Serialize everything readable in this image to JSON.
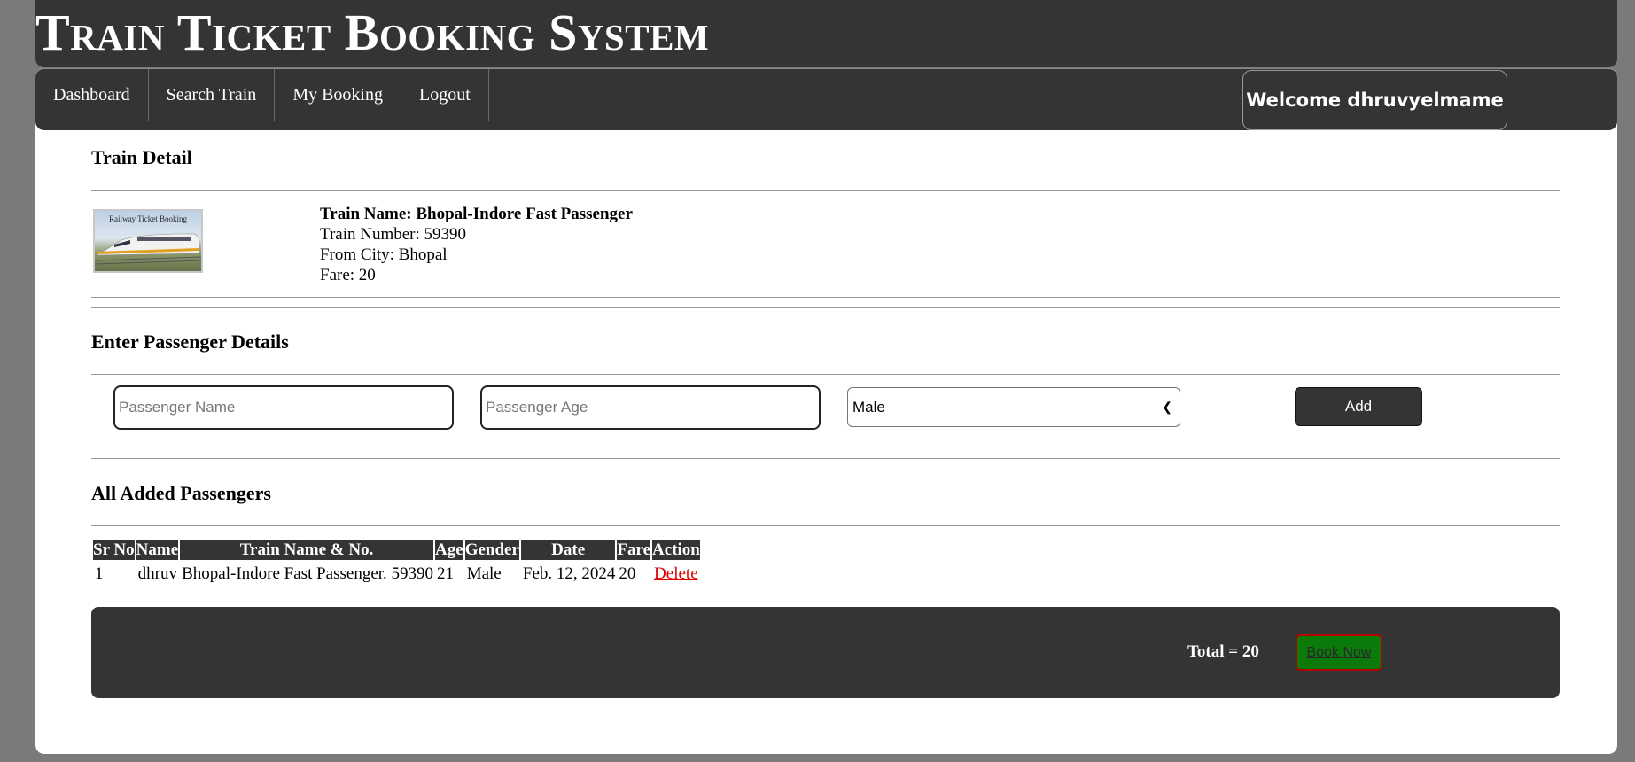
{
  "header": {
    "title": "Train Ticket Booking System"
  },
  "nav": {
    "items": [
      {
        "label": "Dashboard"
      },
      {
        "label": "Search Train"
      },
      {
        "label": "My Booking"
      },
      {
        "label": "Logout"
      }
    ],
    "welcome": "Welcome dhruvyelmame"
  },
  "train_detail": {
    "heading": "Train Detail",
    "image_caption": "Railway Ticket Booking",
    "name_line": "Train Name: Bhopal-Indore Fast Passenger",
    "number_line": "Train Number: 59390",
    "from_line": "From City: Bhopal",
    "fare_line": "Fare: 20"
  },
  "passenger_form": {
    "heading": "Enter Passenger Details",
    "name_placeholder": "Passenger Name",
    "age_placeholder": "Passenger Age",
    "gender_selected": "Male",
    "add_label": "Add"
  },
  "passengers": {
    "heading": "All Added Passengers",
    "columns": [
      "Sr No",
      "Name",
      "Train Name & No.",
      "Age",
      "Gender",
      "Date",
      "Fare",
      "Action"
    ],
    "rows": [
      {
        "sr": "1",
        "name": "dhruv",
        "train": "Bhopal-Indore Fast Passenger. 59390",
        "age": "21",
        "gender": "Male",
        "date": "Feb. 12, 2024",
        "fare": "20",
        "action": "Delete"
      }
    ]
  },
  "footer": {
    "total": "Total = 20",
    "book_label": "Book Now"
  },
  "colors": {
    "dark": "#343434",
    "page_bg": "#7a7a7a",
    "book_green": "#0a7a0a",
    "delete_red": "#e00000"
  }
}
